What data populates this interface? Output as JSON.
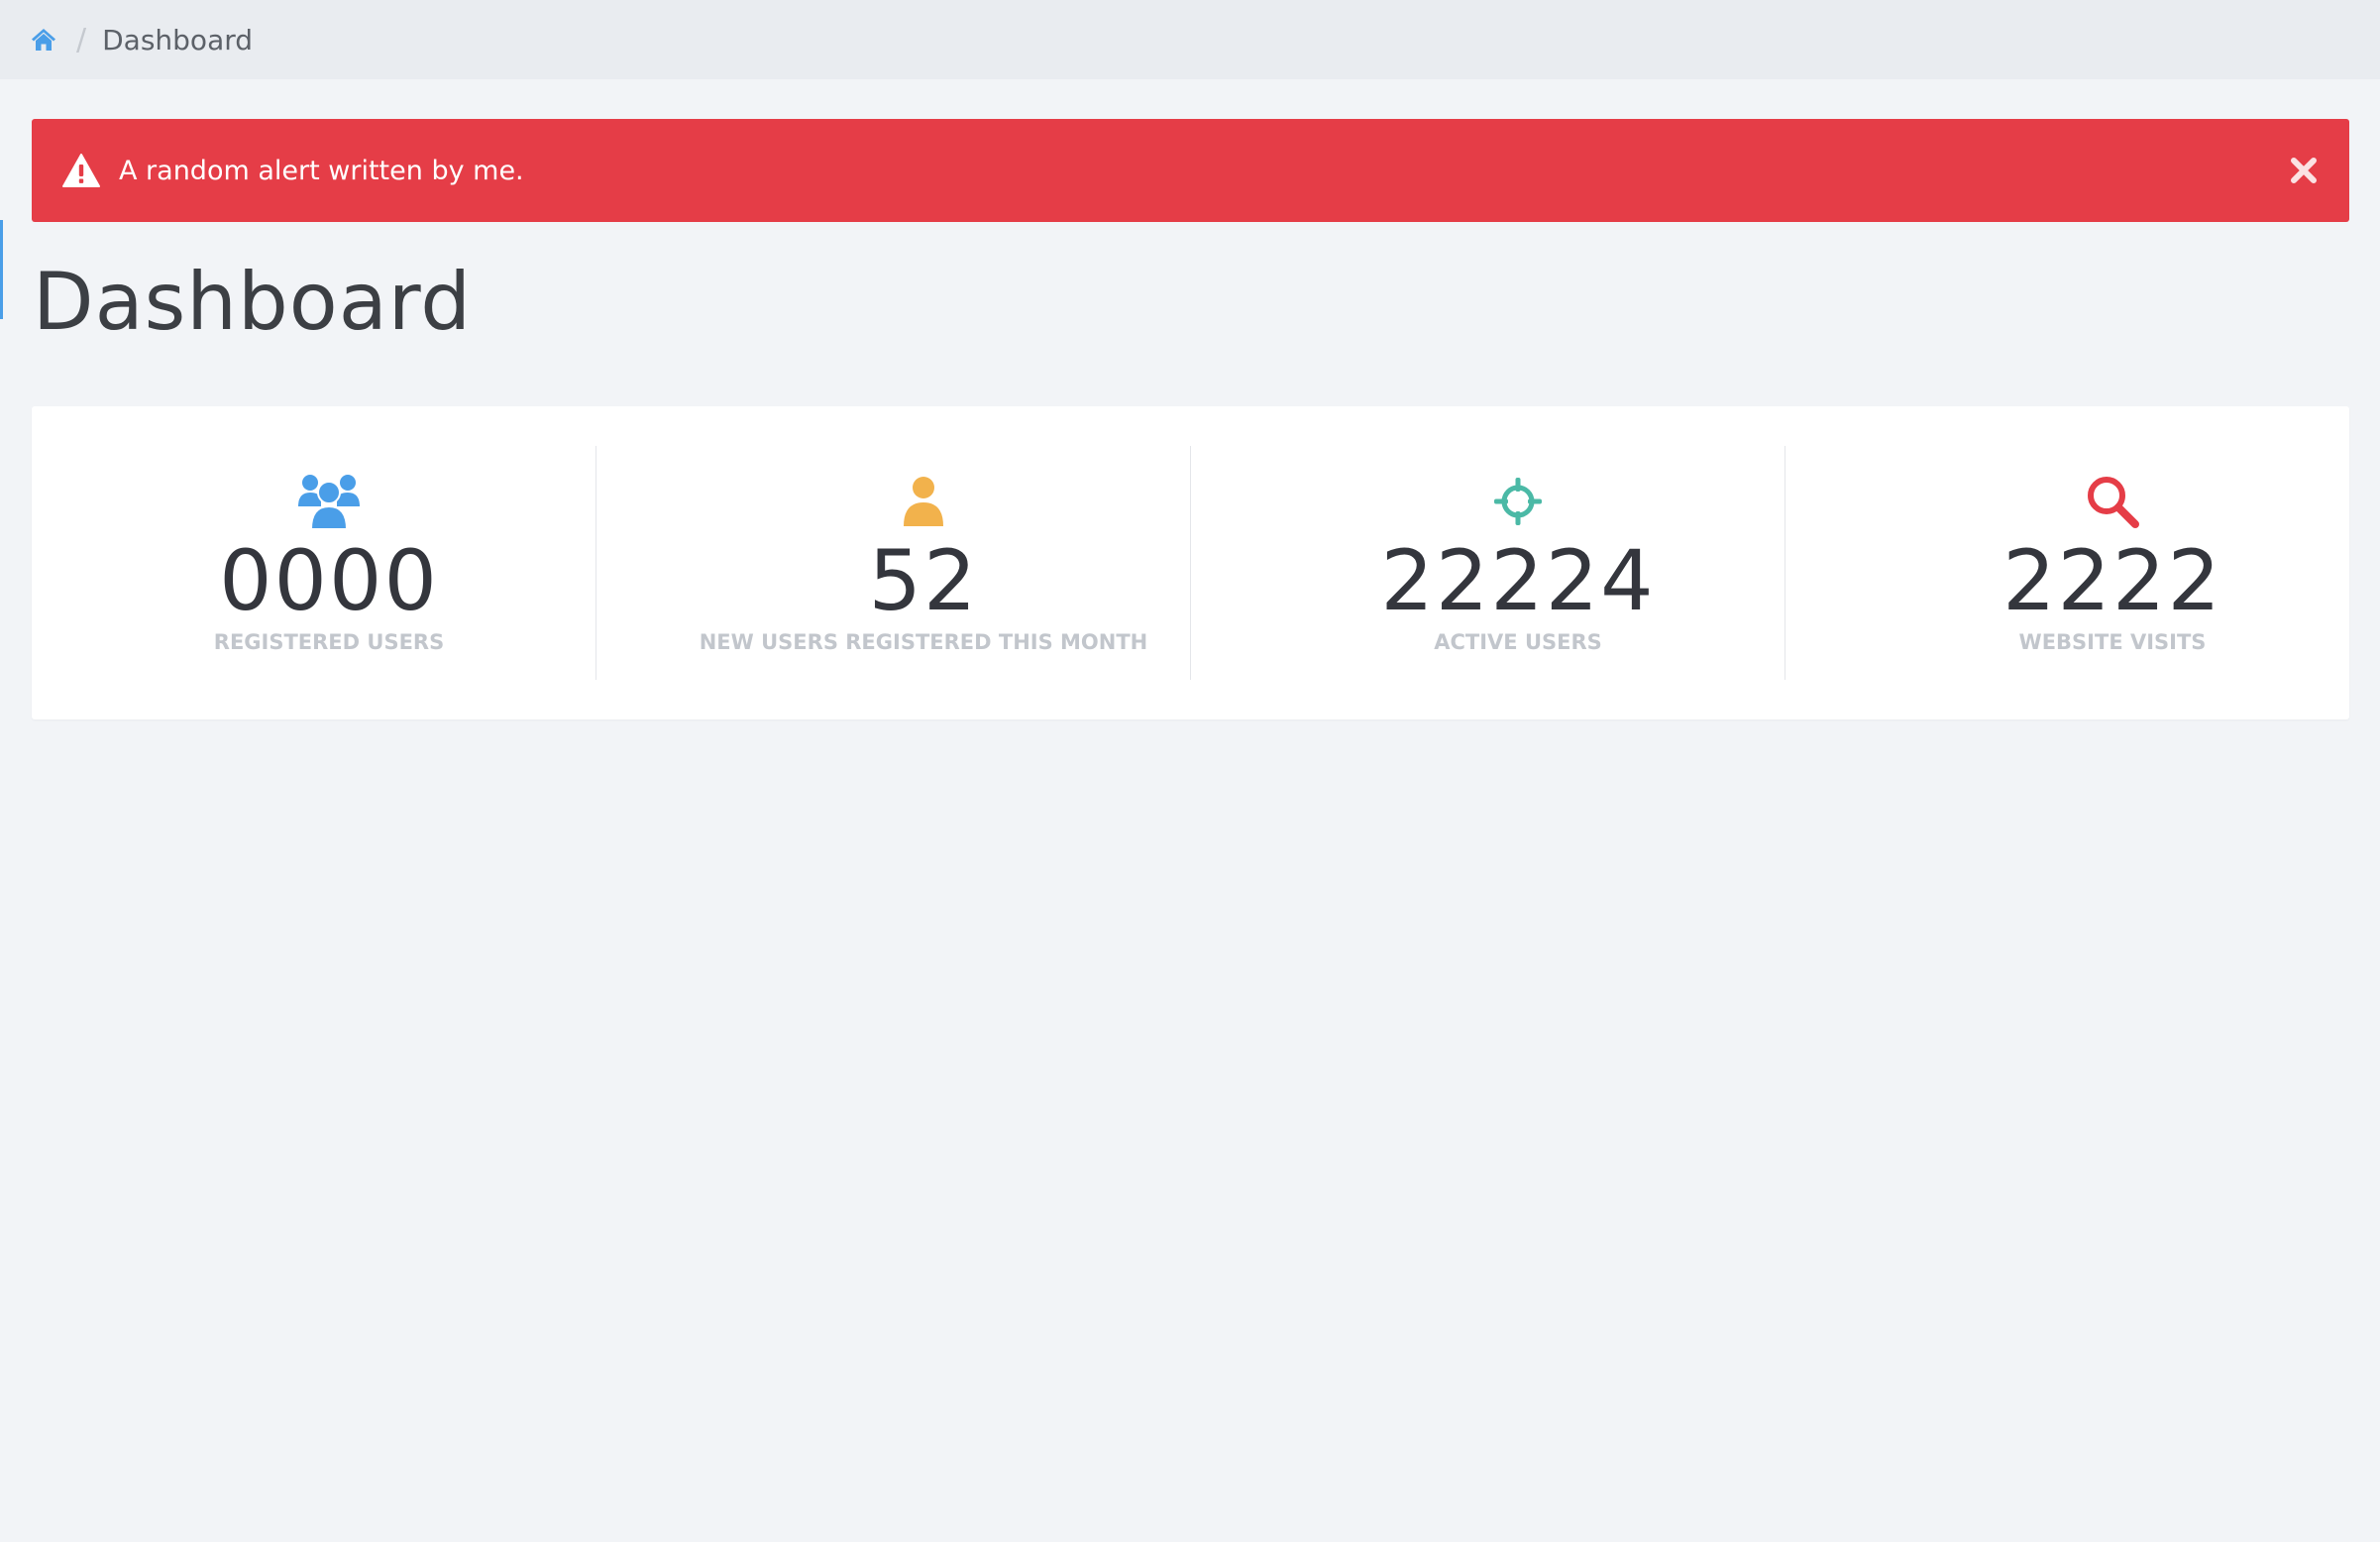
{
  "breadcrumb": {
    "home_icon": "home-icon",
    "separator": "/",
    "current": "Dashboard"
  },
  "alert": {
    "icon": "warning-icon",
    "text": "A random alert written by me.",
    "close_icon": "close-icon",
    "color": "#e53d47"
  },
  "page": {
    "title": "Dashboard"
  },
  "stats": [
    {
      "icon": "users-icon",
      "value": "0000",
      "label": "REGISTERED USERS",
      "color": "#4a9ee8"
    },
    {
      "icon": "user-icon",
      "value": "52",
      "label": "NEW USERS REGISTERED THIS MONTH",
      "color": "#f2b24c"
    },
    {
      "icon": "crosshairs-icon",
      "value": "22224",
      "label": "ACTIVE USERS",
      "color": "#4bb9a6"
    },
    {
      "icon": "search-icon",
      "value": "2222",
      "label": "WEBSITE VISITS",
      "color": "#e53d47"
    }
  ]
}
